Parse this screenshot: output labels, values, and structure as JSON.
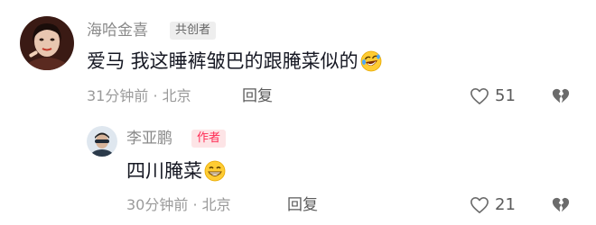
{
  "comment": {
    "username": "海哈金喜",
    "badge": "共创者",
    "text": "爱马 我这睡裤皱巴的跟腌菜似的",
    "emoji": "rolling-on-floor-laughing",
    "time_location": "31分钟前 · 北京",
    "reply_label": "回复",
    "likes": "51"
  },
  "reply": {
    "username": "李亚鹏",
    "badge": "作者",
    "text": "四川腌菜",
    "emoji": "grinning-face",
    "time_location": "30分钟前 · 北京",
    "reply_label": "回复",
    "likes": "21"
  },
  "colors": {
    "author_badge": "#fe2c55",
    "text": "#161823",
    "muted": "#9a9a9a"
  }
}
